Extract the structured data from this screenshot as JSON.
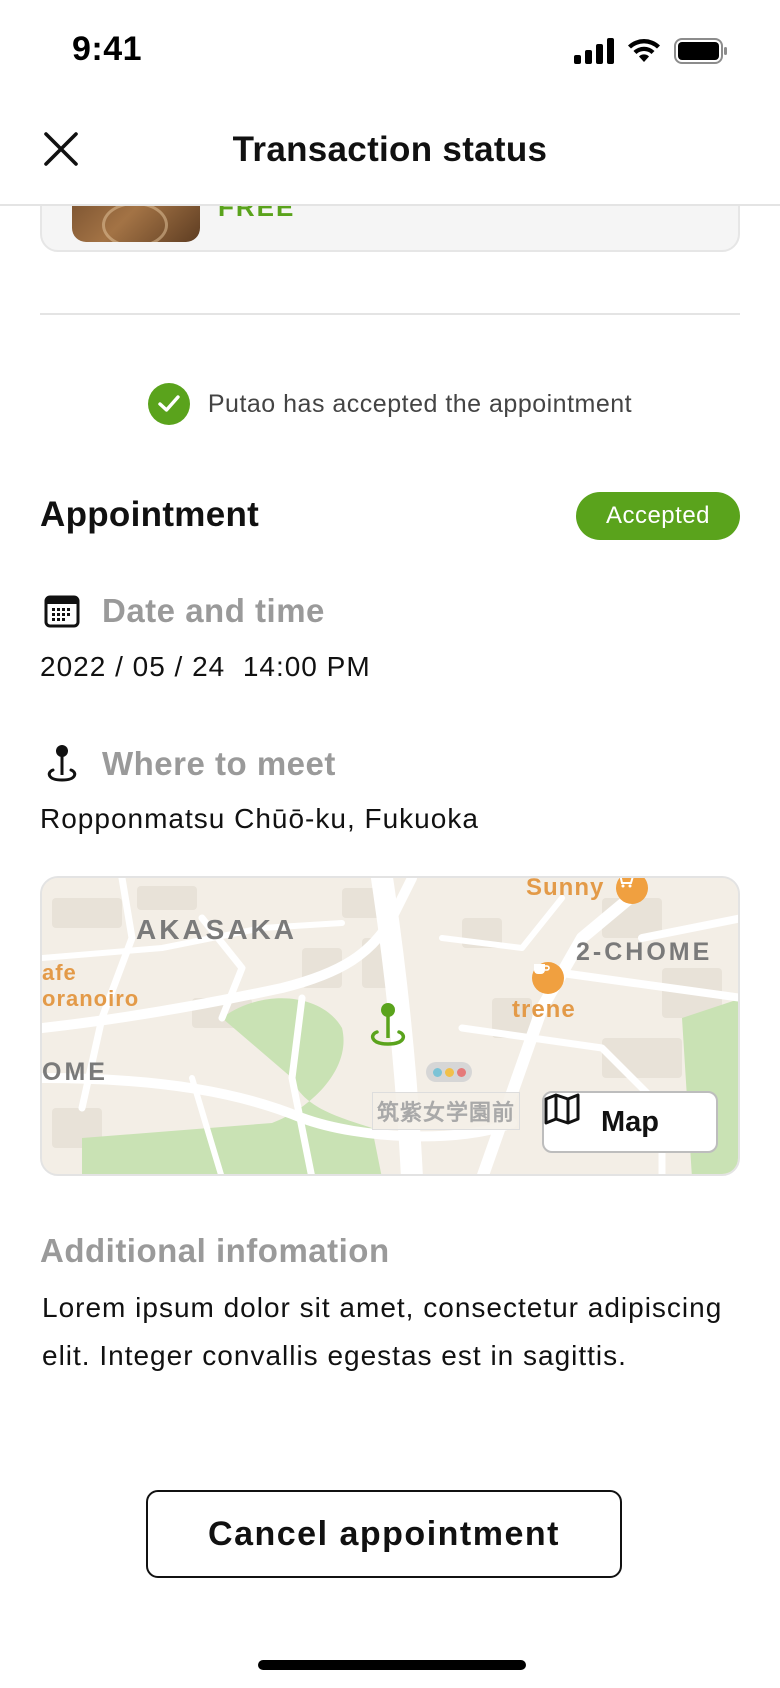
{
  "status_bar": {
    "time": "9:41",
    "icons": [
      "cellular-signal-icon",
      "wifi-icon",
      "battery-icon"
    ]
  },
  "header": {
    "title": "Transaction status",
    "close_icon": "close-icon"
  },
  "item": {
    "price": "FREE"
  },
  "notice": {
    "text": "Putao has accepted the appointment",
    "icon": "check-circle-icon"
  },
  "appointment": {
    "title": "Appointment",
    "status": "Accepted",
    "date_label": "Date and time",
    "date_value": "2022 / 05 / 24  14:00 PM",
    "place_label": "Where to meet",
    "place_value": "Ropponmatsu Chūō-ku, Fukuoka"
  },
  "map": {
    "labels": {
      "akasaka": "AKASAKA",
      "sunny": "Sunny",
      "chome2": "2-CHOME",
      "trene": "trene",
      "cafe1": "afe",
      "cafe2": "oranoiro",
      "ome": "OME",
      "station": "筑紫女学園前"
    },
    "button_label": "Map"
  },
  "additional": {
    "label": "Additional infomation",
    "text": "Lorem ipsum dolor sit amet, consectetur adipiscing elit. Integer convallis egestas est in sagittis."
  },
  "actions": {
    "cancel_label": "Cancel appointment"
  },
  "colors": {
    "accent_green": "#5aa31c",
    "muted_label": "#9a9a9a",
    "border": "#e4e4e4",
    "map_poi_orange": "#f0a040"
  }
}
